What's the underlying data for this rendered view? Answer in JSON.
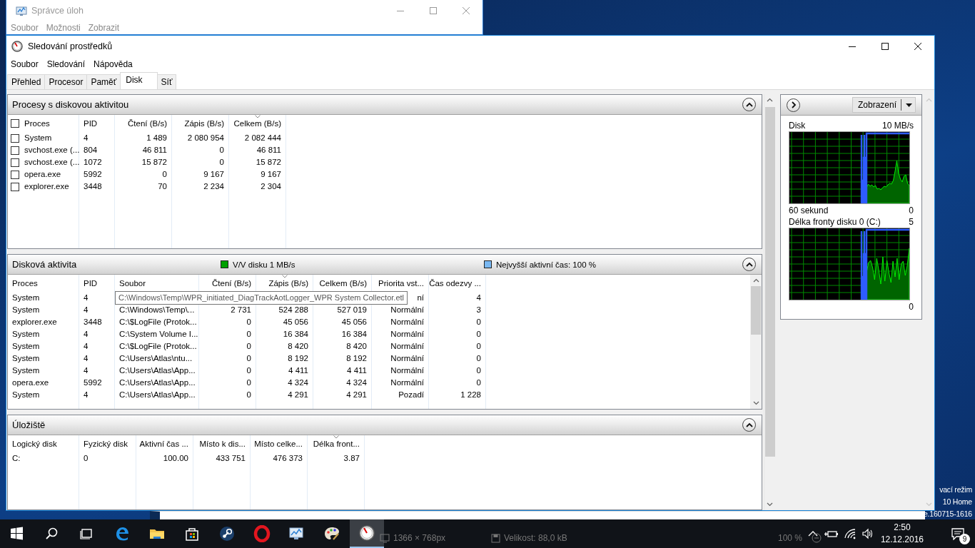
{
  "task_manager": {
    "title": "Správce úloh",
    "menu": [
      "Soubor",
      "Možnosti",
      "Zobrazit"
    ]
  },
  "window": {
    "title": "Sledování prostředků",
    "menu": [
      "Soubor",
      "Sledování",
      "Nápověda"
    ],
    "tabs": [
      {
        "label": "Přehled",
        "selected": false
      },
      {
        "label": "Procesor",
        "selected": false
      },
      {
        "label": "Paměť",
        "selected": false
      },
      {
        "label": "Disk",
        "selected": true
      },
      {
        "label": "Síť",
        "selected": false
      }
    ]
  },
  "processes": {
    "title": "Procesy s diskovou aktivitou",
    "expanded": true,
    "header_checked": false,
    "columns": [
      {
        "label": "Proces",
        "sorted": false
      },
      {
        "label": "PID",
        "sorted": false
      },
      {
        "label": "Čtení (B/s)",
        "sorted": false
      },
      {
        "label": "Zápis (B/s)",
        "sorted": false
      },
      {
        "label": "Celkem (B/s)",
        "sorted": true
      }
    ],
    "rows": [
      {
        "checked": false,
        "cells": [
          "System",
          "4",
          "1 489",
          "2 080 954",
          "2 082 444"
        ]
      },
      {
        "checked": false,
        "cells": [
          "svchost.exe (...",
          "804",
          "46 811",
          "0",
          "46 811"
        ]
      },
      {
        "checked": false,
        "cells": [
          "svchost.exe (...",
          "1072",
          "15 872",
          "0",
          "15 872"
        ]
      },
      {
        "checked": false,
        "cells": [
          "opera.exe",
          "5992",
          "0",
          "9 167",
          "9 167"
        ]
      },
      {
        "checked": false,
        "cells": [
          "explorer.exe",
          "3448",
          "70",
          "2 234",
          "2 304"
        ]
      }
    ]
  },
  "disk_activity": {
    "title": "Disková aktivita",
    "expanded": true,
    "legend": [
      {
        "label": "V/V disku 1 MB/s",
        "color": "#00a000"
      },
      {
        "label": "Nejvyšší aktivní čas: 100 %",
        "color": "#79b8f2"
      }
    ],
    "columns": [
      {
        "label": "Proces",
        "sorted": false
      },
      {
        "label": "PID",
        "sorted": false
      },
      {
        "label": "Soubor",
        "sorted": false
      },
      {
        "label": "Čtení (B/s)",
        "sorted": false
      },
      {
        "label": "Zápis (B/s)",
        "sorted": true
      },
      {
        "label": "Celkem (B/s)",
        "sorted": false
      },
      {
        "label": "Priorita vst...",
        "sorted": false
      },
      {
        "label": "Čas odezvy ...",
        "sorted": false
      }
    ],
    "rows": [
      {
        "cells": [
          "System",
          "4",
          null,
          null,
          null,
          null,
          "ní",
          "4"
        ]
      },
      {
        "cells": [
          "System",
          "4",
          "C:\\Windows\\Temp\\...",
          "2 731",
          "524 288",
          "527 019",
          "Normální",
          "3"
        ]
      },
      {
        "cells": [
          "explorer.exe",
          "3448",
          "C:\\$LogFile (Protok...",
          "0",
          "45 056",
          "45 056",
          "Normální",
          "0"
        ]
      },
      {
        "cells": [
          "System",
          "4",
          "C:\\System Volume I...",
          "0",
          "16 384",
          "16 384",
          "Normální",
          "0"
        ]
      },
      {
        "cells": [
          "System",
          "4",
          "C:\\$LogFile (Protok...",
          "0",
          "8 420",
          "8 420",
          "Normální",
          "0"
        ]
      },
      {
        "cells": [
          "System",
          "4",
          "C:\\Users\\Atlas\\ntu...",
          "0",
          "8 192",
          "8 192",
          "Normální",
          "0"
        ]
      },
      {
        "cells": [
          "System",
          "4",
          "C:\\Users\\Atlas\\App...",
          "0",
          "4 411",
          "4 411",
          "Normální",
          "0"
        ]
      },
      {
        "cells": [
          "opera.exe",
          "5992",
          "C:\\Users\\Atlas\\App...",
          "0",
          "4 324",
          "4 324",
          "Normální",
          "0"
        ]
      },
      {
        "cells": [
          "System",
          "4",
          "C:\\Users\\Atlas\\App...",
          "0",
          "4 291",
          "4 291",
          "Pozadí",
          "1 228"
        ]
      }
    ],
    "tooltip": "C:\\Windows\\Temp\\WPR_initiated_DiagTrackAotLogger_WPR System Collector.etl"
  },
  "storage": {
    "title": "Úložiště",
    "expanded": true,
    "columns": [
      {
        "label": "Logický disk",
        "sorted": false
      },
      {
        "label": "Fyzický disk",
        "sorted": false
      },
      {
        "label": "Aktivní čas ...",
        "sorted": false
      },
      {
        "label": "Místo k dis...",
        "sorted": false
      },
      {
        "label": "Místo celke...",
        "sorted": false
      },
      {
        "label": "Délka front...",
        "sorted": true
      }
    ],
    "rows": [
      {
        "cells": [
          "C:",
          "0",
          "100.00",
          "433 751",
          "476 373",
          "3.87"
        ]
      }
    ]
  },
  "graphs_panel": {
    "view_button": "Zobrazení",
    "graphs": [
      {
        "title": "Disk",
        "max": "10 MB/s",
        "time": "60 sekund",
        "min": "0"
      },
      {
        "title": "Délka fronty disku 0 (C:)",
        "max": "5",
        "min": "0"
      }
    ]
  },
  "desktop_notice": [
    "vací režim",
    "10 Home",
    "e.160715-1616"
  ],
  "viewer_status": {
    "dimensions": "1366 × 768px",
    "file_size": "Velikost: 88,0 kB",
    "zoom": "100 %"
  },
  "taskbar": {
    "items": [
      {
        "kind": "start",
        "selected": false
      },
      {
        "kind": "search",
        "selected": false
      },
      {
        "kind": "taskview",
        "selected": false
      },
      {
        "kind": "browser",
        "selected": false
      },
      {
        "kind": "folder",
        "selected": false
      },
      {
        "kind": "store",
        "selected": false
      },
      {
        "kind": "launcher",
        "selected": false
      },
      {
        "kind": "ring",
        "selected": false
      },
      {
        "kind": "monitor",
        "selected": false
      },
      {
        "kind": "palette",
        "selected": false
      },
      {
        "kind": "gauge",
        "selected": true
      }
    ],
    "time": "2:50",
    "date": "12.12.2016",
    "notifications": "9"
  }
}
